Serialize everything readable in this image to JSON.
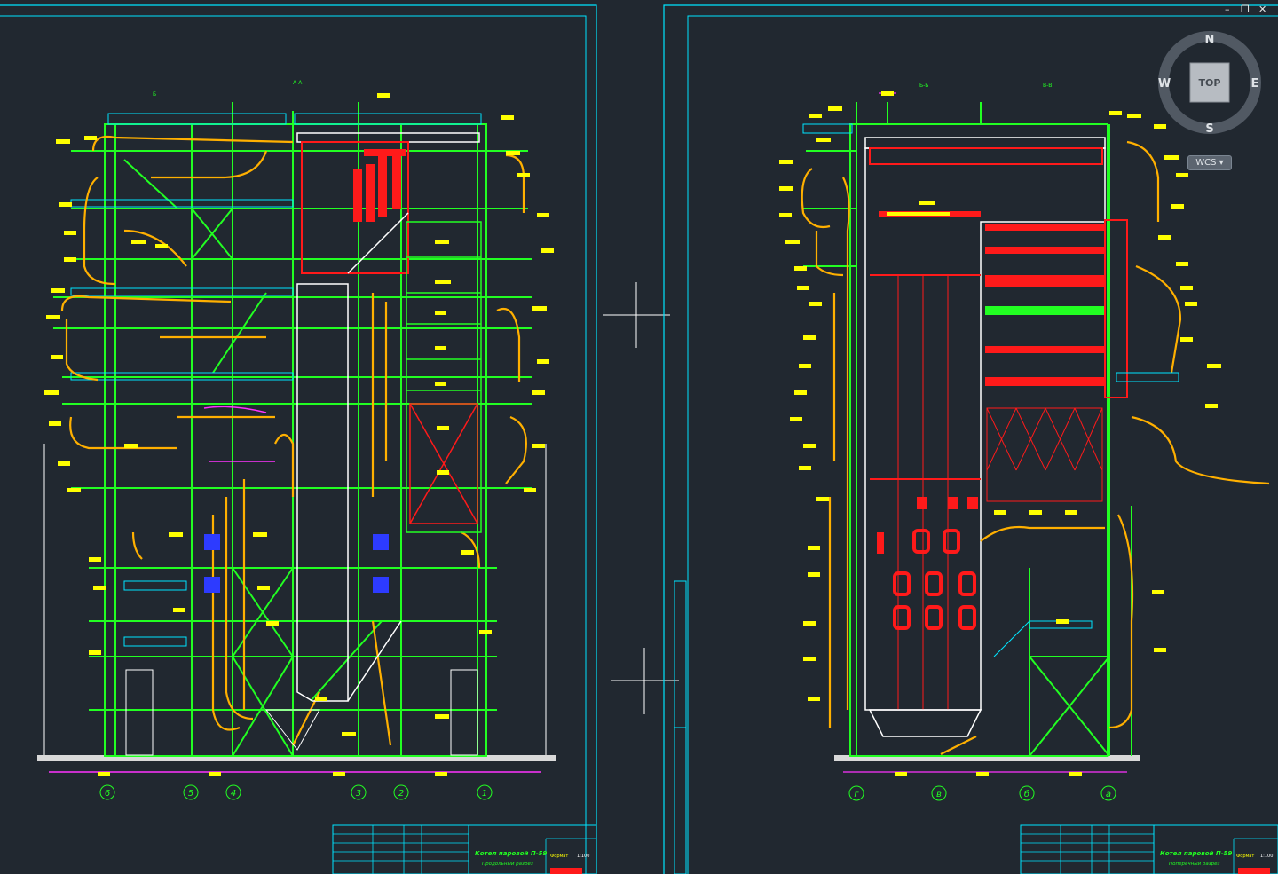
{
  "window": {
    "minimize_glyph": "–",
    "restore_glyph": "❐",
    "close_glyph": "✕"
  },
  "viewcube": {
    "face": "TOP",
    "north": "N",
    "south": "S",
    "east": "E",
    "west": "W"
  },
  "wcs_label": "WCS",
  "colors": {
    "background": "#212830",
    "frame": "#00e5ff",
    "structure": "#22ff22",
    "pipes": "#ffb000",
    "hot": "#ff1a1a",
    "labels": "#ffff00",
    "dims": "#ff33ff",
    "white": "#ffffff",
    "blue": "#2d3bff"
  },
  "left_sheet": {
    "section_marks": [
      "А-А",
      "Б"
    ],
    "axis_labels": [
      "6",
      "5",
      "4",
      "3",
      "2",
      "1"
    ],
    "title_block": {
      "title": "Котел паровой П-59",
      "subtitle": "Продольный разрез",
      "sheet_label": "Формат",
      "scale": "1:100"
    }
  },
  "right_sheet": {
    "section_marks": [
      "Б-Б",
      "В-В"
    ],
    "axis_labels": [
      "г",
      "в",
      "б",
      "а"
    ],
    "title_block": {
      "title": "Котел паровой П-59",
      "subtitle": "Поперечный разрез",
      "sheet_label": "Формат",
      "scale": "1:100"
    }
  }
}
